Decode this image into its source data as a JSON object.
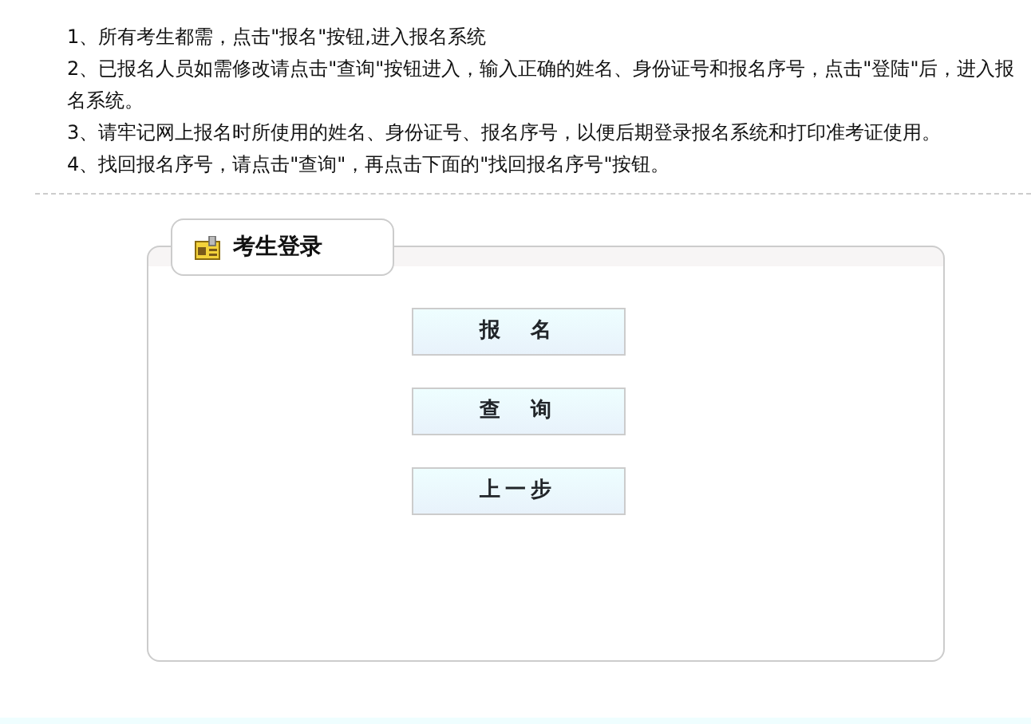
{
  "instructions": [
    "1、所有考生都需，点击\"报名\"按钮,进入报名系统",
    "2、已报名人员如需修改请点击\"查询\"按钮进入，输入正确的姓名、身份证号和报名序号，点击\"登陆\"后，进入报名系统。",
    "3、请牢记网上报名时所使用的姓名、身份证号、报名序号，以便后期登录报名系统和打印准考证使用。",
    "4、找回报名序号，请点击\"查询\"，再点击下面的\"找回报名序号\"按钮。"
  ],
  "panel": {
    "title": "考生登录",
    "buttons": [
      "报　名",
      "查　询",
      "上一步"
    ]
  }
}
